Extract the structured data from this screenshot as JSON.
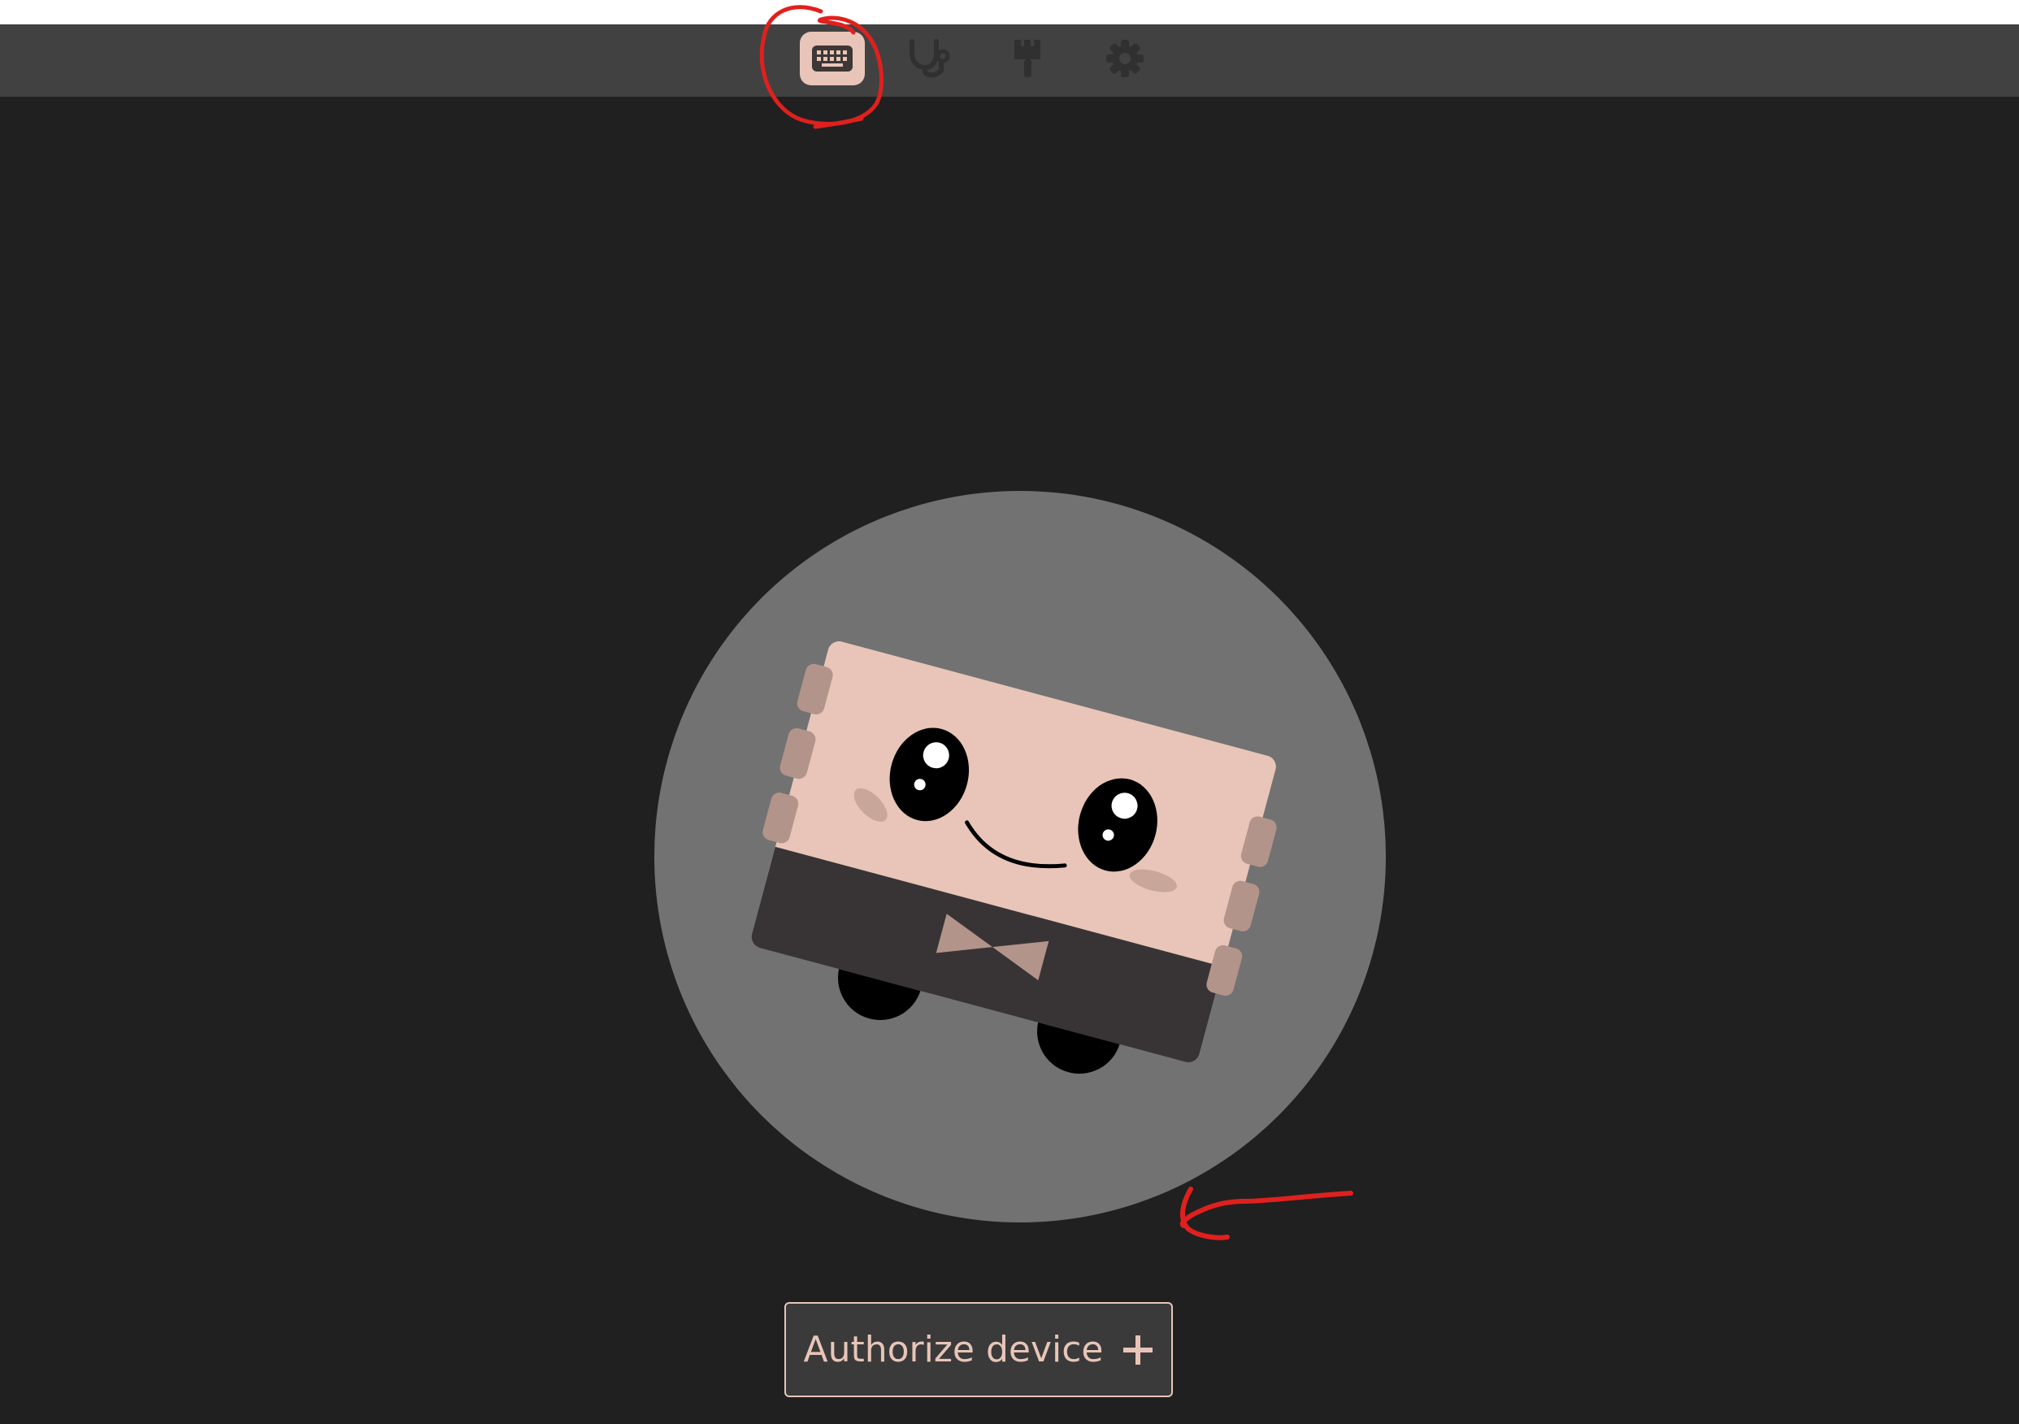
{
  "toolbar": {
    "items": [
      {
        "icon": "keyboard-icon",
        "active": true
      },
      {
        "icon": "stethoscope-icon",
        "active": false
      },
      {
        "icon": "paint-brush-icon",
        "active": false
      },
      {
        "icon": "gear-icon",
        "active": false
      }
    ]
  },
  "main": {
    "authorize_label": "Authorize device",
    "authorize_icon": "plus-icon"
  },
  "colors": {
    "toolbar_bg": "#414141",
    "page_bg": "#202020",
    "accent": "#e8c5b8",
    "annotation": "#e0201e"
  }
}
